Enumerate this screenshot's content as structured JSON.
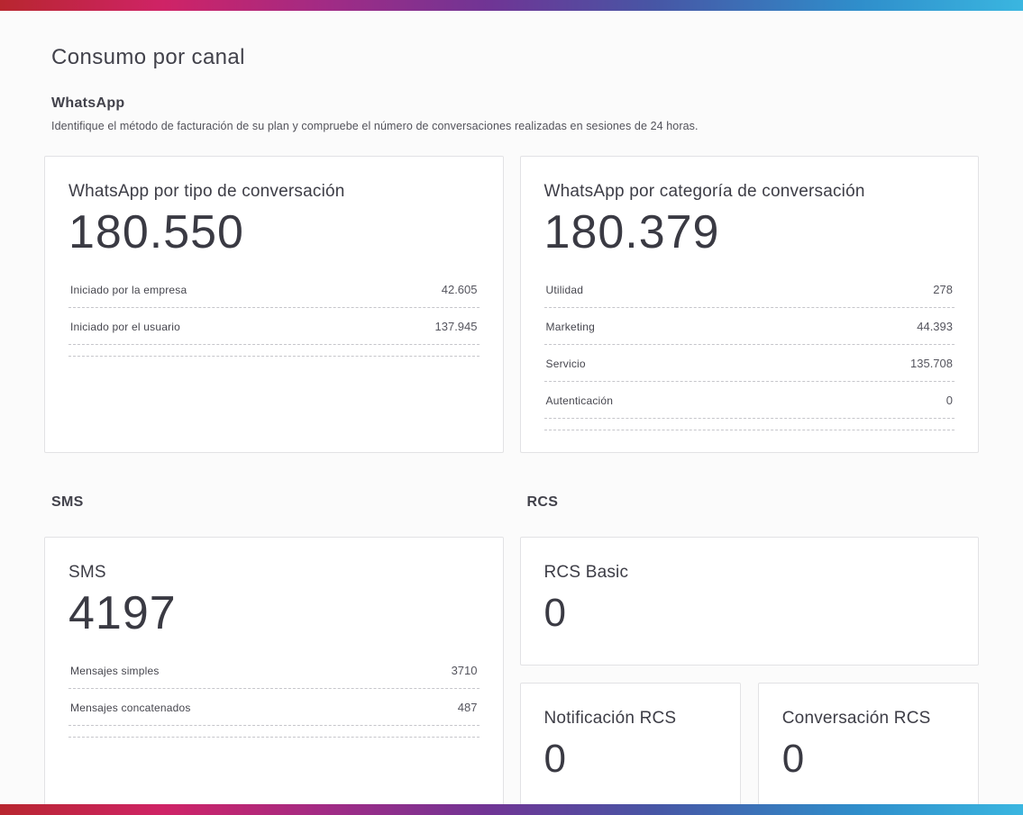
{
  "page": {
    "title": "Consumo por canal"
  },
  "sections": {
    "whatsapp": {
      "title": "WhatsApp",
      "description": "Identifique el método de facturación de su plan y compruebe el número de conversaciones realizadas en sesiones de 24 horas."
    },
    "sms": {
      "title": "SMS"
    },
    "rcs": {
      "title": "RCS"
    }
  },
  "cards": {
    "whatsapp_tipo": {
      "title": "WhatsApp por tipo de conversación",
      "total": "180.550",
      "rows": [
        {
          "label": "Iniciado por la empresa",
          "value": "42.605"
        },
        {
          "label": "Iniciado por el usuario",
          "value": "137.945"
        }
      ]
    },
    "whatsapp_categoria": {
      "title": "WhatsApp por categoría de conversación",
      "total": "180.379",
      "rows": [
        {
          "label": "Utilidad",
          "value": "278"
        },
        {
          "label": "Marketing",
          "value": "44.393"
        },
        {
          "label": "Servicio",
          "value": "135.708"
        },
        {
          "label": "Autenticación",
          "value": "0"
        }
      ]
    },
    "sms": {
      "title": "SMS",
      "total": "4197",
      "rows": [
        {
          "label": "Mensajes simples",
          "value": "3710"
        },
        {
          "label": "Mensajes concatenados",
          "value": "487"
        }
      ]
    },
    "rcs_basic": {
      "title": "RCS Basic",
      "total": "0"
    },
    "rcs_notificacion": {
      "title": "Notificación RCS",
      "total": "0"
    },
    "rcs_conversacion": {
      "title": "Conversación RCS",
      "total": "0"
    }
  },
  "colors": {
    "brand_gradient": [
      "#b8262f",
      "#cf2366",
      "#a12b85",
      "#6f3595",
      "#4756a5",
      "#2f8ecb",
      "#3ab6e0"
    ],
    "page_background": "#fbfbfb",
    "card_background": "#ffffff",
    "text_primary": "#3d3d46",
    "text_secondary": "#55555e",
    "dashed_divider": "#c6c6cb"
  }
}
